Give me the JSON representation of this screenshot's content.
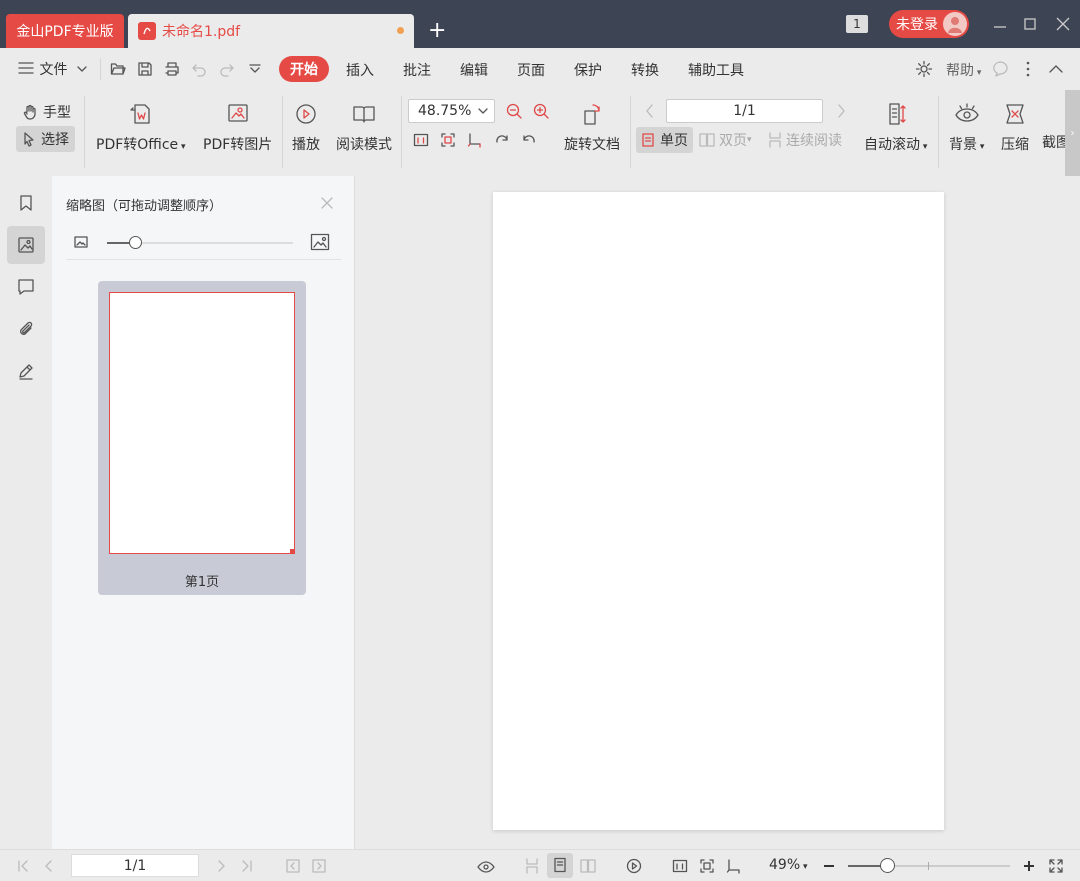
{
  "titlebar": {
    "app_tab": "金山PDF专业版",
    "doc_tab": "未命名1.pdf",
    "window_count": "1",
    "login_label": "未登录"
  },
  "menu": {
    "file": "文件",
    "tabs": [
      "开始",
      "插入",
      "批注",
      "编辑",
      "页面",
      "保护",
      "转换",
      "辅助工具"
    ],
    "help": "帮助"
  },
  "toolbar": {
    "hand": "手型",
    "select": "选择",
    "pdf_to_office": "PDF转Office",
    "pdf_to_image": "PDF转图片",
    "play": "播放",
    "read_mode": "阅读模式",
    "zoom_value": "48.75%",
    "rotate_doc": "旋转文档",
    "page_value": "1/1",
    "single_page": "单页",
    "double_page": "双页",
    "continuous": "连续阅读",
    "auto_scroll": "自动滚动",
    "background": "背景",
    "compress": "压缩",
    "screenshot": "截图"
  },
  "thumbnail_panel": {
    "title": "缩略图（可拖动调整顺序）",
    "slider_level": 0.15,
    "page_label": "第1页"
  },
  "statusbar": {
    "page_value": "1/1",
    "zoom": "49%",
    "zoom_level": 0.24
  },
  "colors": {
    "accent": "#e64a45",
    "titlebar": "#3d4454"
  }
}
